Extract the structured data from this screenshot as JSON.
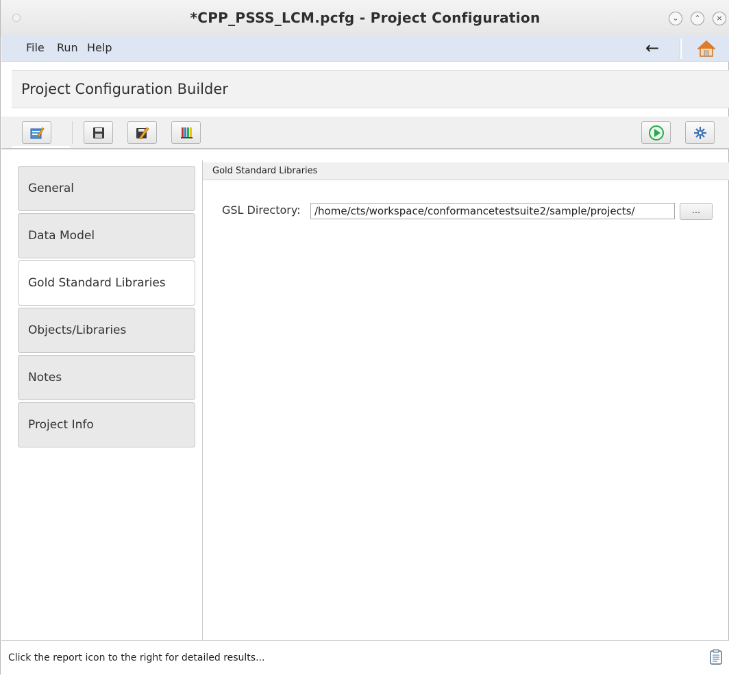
{
  "window": {
    "title": "*CPP_PSSS_LCM.pcfg - Project Configuration",
    "controls": {
      "minimize": "⌄",
      "maximize": "⌃",
      "close": "×"
    }
  },
  "menu": {
    "items": [
      "File",
      "Run",
      "Help"
    ],
    "back": "←"
  },
  "builder": {
    "title": "Project Configuration Builder"
  },
  "toolbar": {
    "icons": [
      "edit-icon",
      "save-icon",
      "save-as-icon",
      "library-icon",
      "run-icon",
      "settings-icon"
    ]
  },
  "nav": {
    "items": [
      {
        "label": "General",
        "active": false
      },
      {
        "label": "Data Model",
        "active": false
      },
      {
        "label": "Gold Standard Libraries",
        "active": true
      },
      {
        "label": "Objects/Libraries",
        "active": false
      },
      {
        "label": "Notes",
        "active": false
      },
      {
        "label": "Project Info",
        "active": false
      }
    ]
  },
  "content": {
    "header": "Gold Standard Libraries",
    "gsl_label": "GSL Directory:",
    "gsl_value": "/home/cts/workspace/conformancetestsuite2/sample/projects/",
    "browse_label": "..."
  },
  "status": {
    "text": "Click the report icon to the right for detailed results..."
  },
  "colors": {
    "menubar_bg": "#dde6f2",
    "run_green": "#2aa84a",
    "home_orange": "#e07b2a"
  }
}
